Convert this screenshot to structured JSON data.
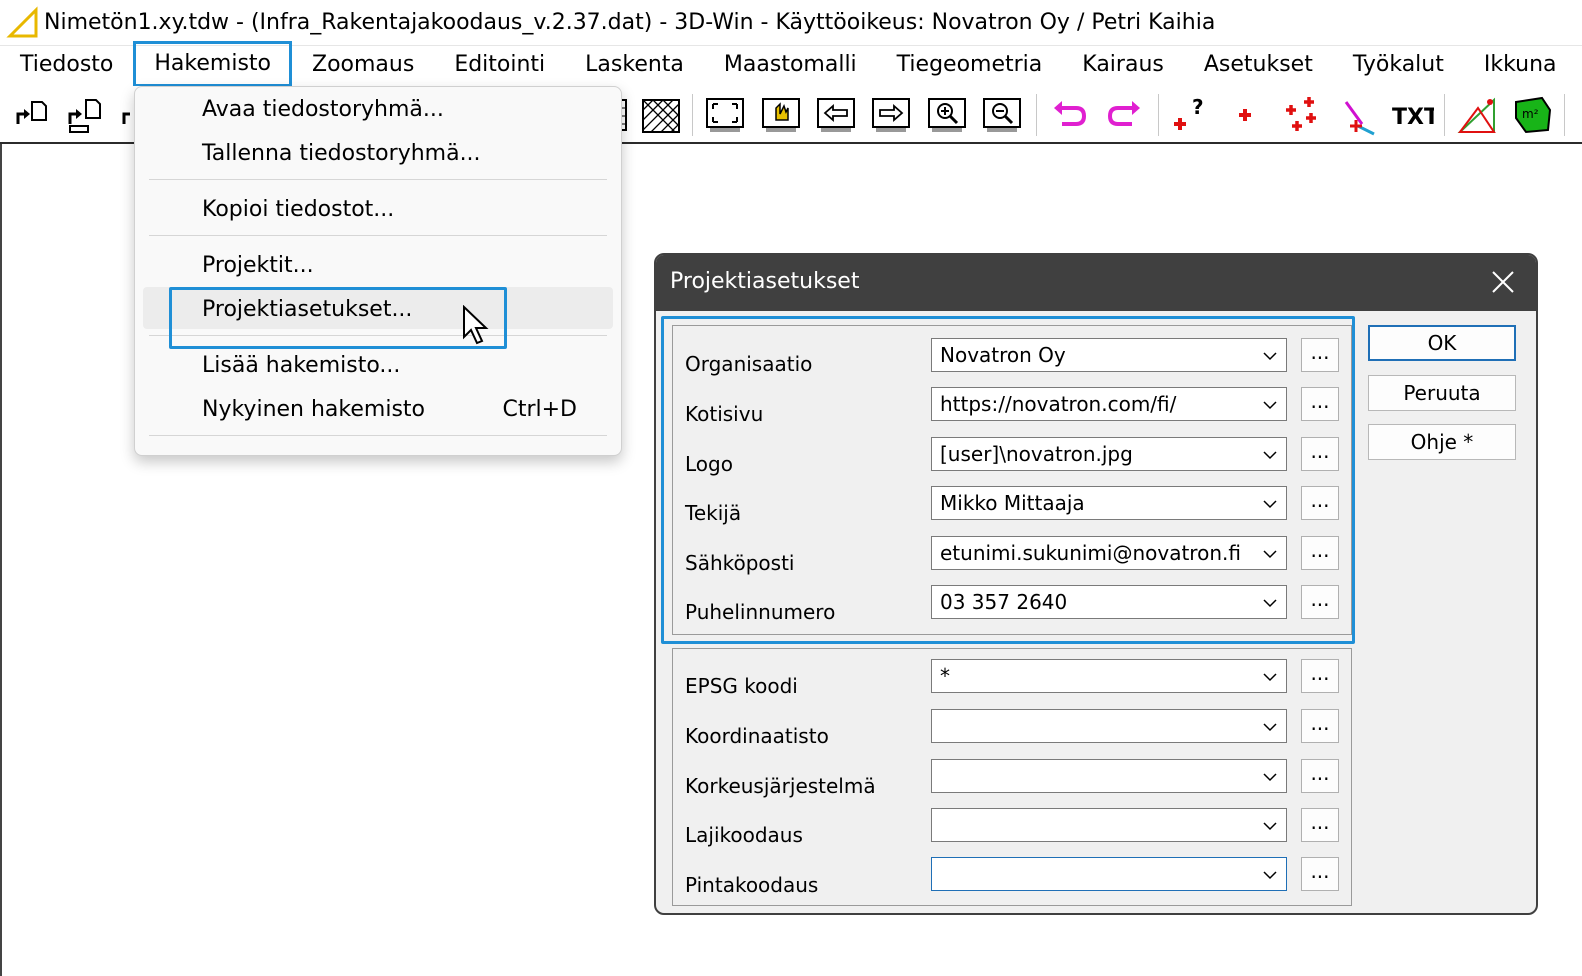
{
  "window": {
    "title": "Nimetön1.xy.tdw - (Infra_Rakentajakoodaus_v.2.37.dat) - 3D-Win - Käyttöoikeus: Novatron Oy / Petri Kaihia",
    "icon": "3dwin-triangle-icon"
  },
  "menubar": {
    "items": [
      {
        "label": "Tiedosto"
      },
      {
        "label": "Hakemisto",
        "active": true
      },
      {
        "label": "Zoomaus"
      },
      {
        "label": "Editointi"
      },
      {
        "label": "Laskenta"
      },
      {
        "label": "Maastomalli"
      },
      {
        "label": "Tiegeometria"
      },
      {
        "label": "Kairaus"
      },
      {
        "label": "Asetukset"
      },
      {
        "label": "Työkalut"
      },
      {
        "label": "Ikkuna"
      },
      {
        "label": "O"
      }
    ]
  },
  "toolbar": {
    "icons": [
      "open-file-icon",
      "save-file-icon",
      "file-icon",
      "grid-icon",
      "hatch-icon",
      "zoom-all-icon",
      "pan-hand-icon",
      "zoom-previous-icon",
      "zoom-next-icon",
      "zoom-in-icon",
      "zoom-out-icon",
      "undo-icon",
      "redo-icon",
      "point-query-icon",
      "add-point-icon",
      "multi-point-icon",
      "line-icon",
      "text-icon",
      "triangle-measure-icon",
      "area-icon"
    ],
    "text_tool_label": "TXT",
    "point_query_label": "?",
    "area_label": "m²"
  },
  "dropdown": {
    "items": [
      {
        "label": "Avaa tiedostoryhmä..."
      },
      {
        "label": "Tallenna tiedostoryhmä..."
      },
      {
        "label": "Kopioi tiedostot..."
      },
      {
        "label": "Projektit..."
      },
      {
        "label": "Projektiasetukset..."
      },
      {
        "label": "Lisää hakemisto..."
      },
      {
        "label": "Nykyinen hakemisto",
        "shortcut": "Ctrl+D"
      }
    ]
  },
  "dialog": {
    "title": "Projektiasetukset",
    "group1": [
      {
        "label": "Organisaatio",
        "value": "Novatron Oy"
      },
      {
        "label": "Kotisivu",
        "value": "https://novatron.com/fi/"
      },
      {
        "label": "Logo",
        "value": "[user]\\novatron.jpg"
      },
      {
        "label": "Tekijä",
        "value": "Mikko Mittaaja"
      },
      {
        "label": "Sähköposti",
        "value": "etunimi.sukunimi@novatron.fi"
      },
      {
        "label": "Puhelinnumero",
        "value": "03 357 2640"
      }
    ],
    "group2": [
      {
        "label": "EPSG koodi",
        "value": "*"
      },
      {
        "label": "Koordinaatisto",
        "value": ""
      },
      {
        "label": "Korkeusjärjestelmä",
        "value": ""
      },
      {
        "label": "Lajikoodaus",
        "value": ""
      },
      {
        "label": "Pintakoodaus",
        "value": ""
      }
    ],
    "browse_label": "...",
    "buttons": {
      "ok": "OK",
      "cancel": "Peruuta",
      "help": "Ohje *"
    }
  },
  "colors": {
    "highlight": "#1f8fd6",
    "dialog_titlebar": "#404040",
    "undo_magenta": "#e020d0",
    "point_red": "#e01010",
    "area_green": "#18b418"
  }
}
